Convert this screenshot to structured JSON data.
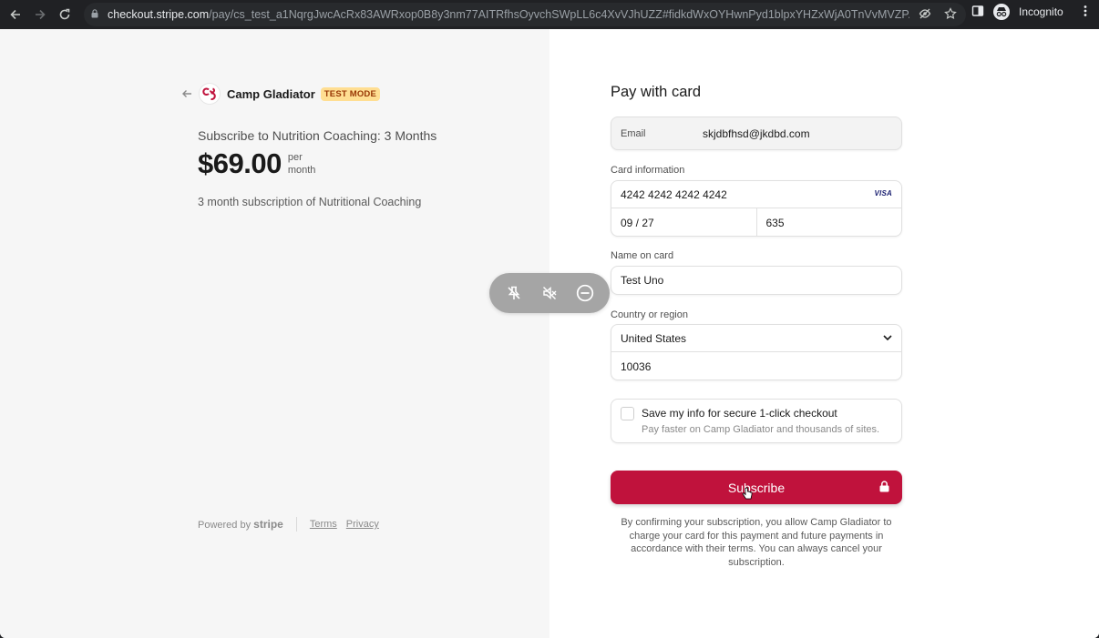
{
  "browser": {
    "url_host": "checkout.stripe.com",
    "url_path": "/pay/cs_test_a1NqrgJwcAcRx83AWRxop0B8y3nm77AITRfhsOyvchSWpLL6c4XvVJhUZZ#fidkdWxOYHwnPyd1blpxYHZxWjA0TnVvMVZP...",
    "profile_label": "Incognito",
    "icons": [
      "back-icon",
      "forward-icon",
      "reload-icon",
      "lock-icon",
      "eye-off-icon",
      "star-icon",
      "side-panel-icon",
      "incognito-icon",
      "menu-icon"
    ]
  },
  "merchant": {
    "name": "Camp Gladiator",
    "badge": "TEST MODE",
    "accent_color": "#c0123c"
  },
  "summary": {
    "product": "Subscribe to Nutrition Coaching: 3 Months",
    "price": "$69.00",
    "per_line1": "per",
    "per_line2": "month",
    "description": "3 month subscription of Nutritional Coaching"
  },
  "footer": {
    "powered_prefix": "Powered by",
    "powered_brand": "stripe",
    "terms": "Terms",
    "privacy": "Privacy"
  },
  "toolbar": {
    "icons": [
      "pin-off-icon",
      "mute-icon",
      "minus-circle-icon"
    ]
  },
  "form": {
    "title": "Pay with card",
    "email_label": "Email",
    "email_value": "skjdbfhsd@jkdbd.com",
    "card_label": "Card information",
    "card_number": "4242 4242 4242 4242",
    "card_brand": "VISA",
    "card_expiry": "09 / 27",
    "card_cvc": "635",
    "name_label": "Name on card",
    "name_value": "Test Uno",
    "country_label": "Country or region",
    "country_value": "United States",
    "zip_value": "10036",
    "save_title": "Save my info for secure 1-click checkout",
    "save_subtitle": "Pay faster on Camp Gladiator and thousands of sites.",
    "save_checked": false,
    "subscribe_label": "Subscribe",
    "consent": "By confirming your subscription, you allow Camp Gladiator to charge your card for this payment and future payments in accordance with their terms. You can always cancel your subscription."
  }
}
